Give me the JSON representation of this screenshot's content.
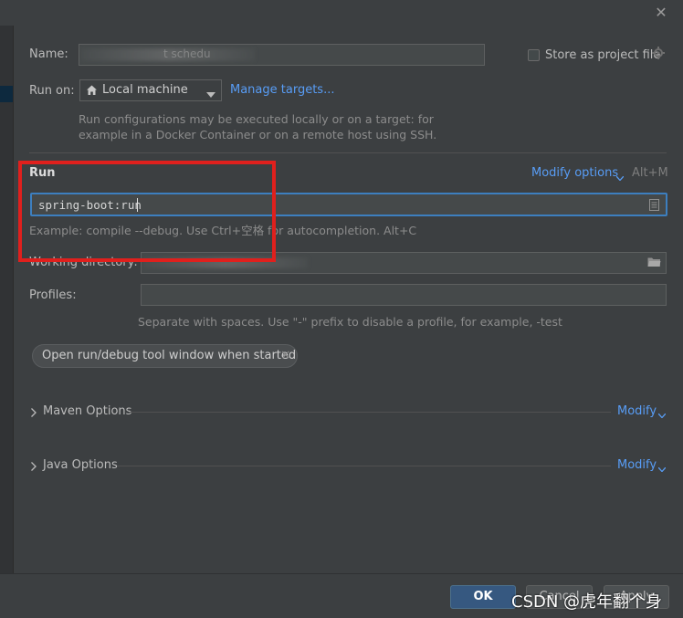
{
  "dialog": {
    "close_glyph": "✕"
  },
  "form": {
    "name_label": "Name:",
    "name_value": "t schedu",
    "store_label": "Store as project file",
    "run_on_label": "Run on:",
    "run_on_value": "Local machine",
    "manage_targets": "Manage targets...",
    "run_on_hint_line1": "Run configurations may be executed locally or on a target: for",
    "run_on_hint_line2": "example in a Docker Container or on a remote host using SSH."
  },
  "run_section": {
    "title": "Run",
    "modify_options": "Modify options",
    "modify_shortcut": "Alt+M",
    "command_value": "spring-boot:run",
    "example_hint": "Example: compile --debug. Use Ctrl+空格 for autocompletion. Alt+C",
    "working_dir_label": "Working directory:",
    "profiles_label": "Profiles:",
    "profiles_value": "",
    "profiles_hint": "Separate with spaces. Use \"-\" prefix to disable a profile, for example, -test",
    "chip_label": "Open run/debug tool window when started",
    "chip_close": "×"
  },
  "maven_options": {
    "label": "Maven Options",
    "modify": "Modify"
  },
  "java_options": {
    "label": "Java Options",
    "modify": "Modify"
  },
  "footer": {
    "ok": "OK",
    "cancel": "Cancel",
    "apply": "Apply"
  },
  "watermark": "CSDN @虎年翻个身",
  "colors": {
    "background": "#3c3f41",
    "link": "#589df6",
    "focus_border": "#3d7fbf",
    "highlight_box": "#e0201d"
  }
}
